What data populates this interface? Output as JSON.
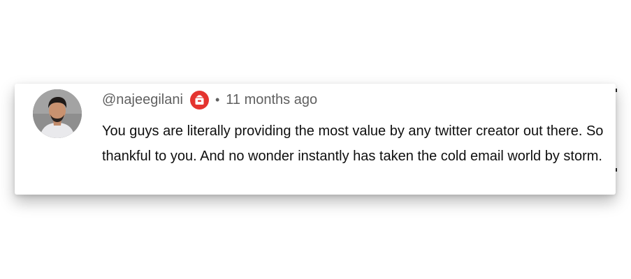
{
  "comment": {
    "username": "@najeegilani",
    "badge_icon": "instantly-logo-icon",
    "badge_color": "#e4342f",
    "separator": "•",
    "timestamp": "11 months ago",
    "text": "You guys are literally providing the most value by any twitter creator out there. So thankful to you. And no wonder instantly has taken the cold email world by storm."
  }
}
